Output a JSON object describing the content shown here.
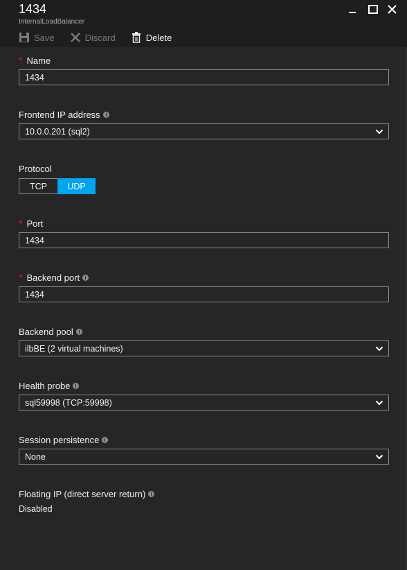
{
  "header": {
    "title": "1434",
    "subtitle": "InternalLoadBalancer"
  },
  "commands": {
    "save": "Save",
    "discard": "Discard",
    "delete": "Delete"
  },
  "form": {
    "name": {
      "label": "Name",
      "value": "1434"
    },
    "frontend_ip": {
      "label": "Frontend IP address",
      "value": "10.0.0.201 (sql2)"
    },
    "protocol": {
      "label": "Protocol",
      "options": [
        "TCP",
        "UDP"
      ],
      "selected": "UDP"
    },
    "port": {
      "label": "Port",
      "value": "1434"
    },
    "backend_port": {
      "label": "Backend port",
      "value": "1434"
    },
    "backend_pool": {
      "label": "Backend pool",
      "value": "ilbBE (2 virtual machines)"
    },
    "health_probe": {
      "label": "Health probe",
      "value": "sql59998 (TCP:59998)"
    },
    "session_persistence": {
      "label": "Session persistence",
      "value": "None"
    },
    "floating_ip": {
      "label": "Floating IP (direct server return)",
      "value": "Disabled"
    }
  },
  "colors": {
    "accent": "#00a4ef",
    "required": "#e81123",
    "background": "#262626"
  }
}
